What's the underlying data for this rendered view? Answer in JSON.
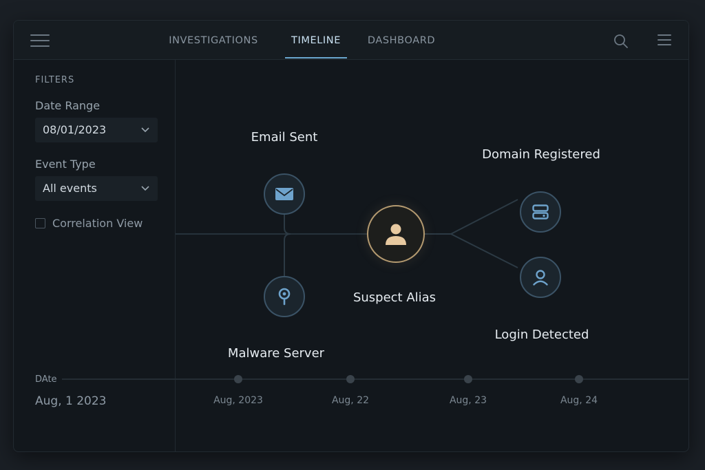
{
  "nav": {
    "tabs": [
      {
        "label": "INVESTIGATIONS"
      },
      {
        "label": "TIMELINE"
      },
      {
        "label": "DASHBOARD"
      }
    ],
    "active_tab": "TIMELINE",
    "icons": [
      "hamburger-icon",
      "search-icon",
      "menu-icon"
    ]
  },
  "sidebar": {
    "heading": "FILTERS",
    "date_range": {
      "label": "Date Range",
      "value": "08/01/2023"
    },
    "event_type": {
      "label": "Event Type",
      "value": "All events"
    },
    "correlation": {
      "label": "Correlation View",
      "checked": false
    },
    "date": {
      "label": "DAte",
      "value": "Aug, 1 2023"
    }
  },
  "graph": {
    "nodes": {
      "email": {
        "label": "Email Sent",
        "icon": "envelope-icon"
      },
      "malware": {
        "label": "Malware Server",
        "icon": "map-pin-icon"
      },
      "suspect": {
        "label": "Suspect Alias",
        "icon": "person-icon"
      },
      "domain": {
        "label": "Domain Registered",
        "icon": "server-icon"
      },
      "login": {
        "label": "Login Detected",
        "icon": "user-icon"
      }
    },
    "colors": {
      "central_ring": "#b49a70",
      "node_ring": "#3b5366",
      "icon_blue": "#6ea3cc",
      "icon_gold": "#e7c9a0"
    }
  },
  "timeline": {
    "ticks": [
      "Aug, 2023",
      "Aug, 22",
      "Aug, 23",
      "Aug, 24"
    ]
  }
}
